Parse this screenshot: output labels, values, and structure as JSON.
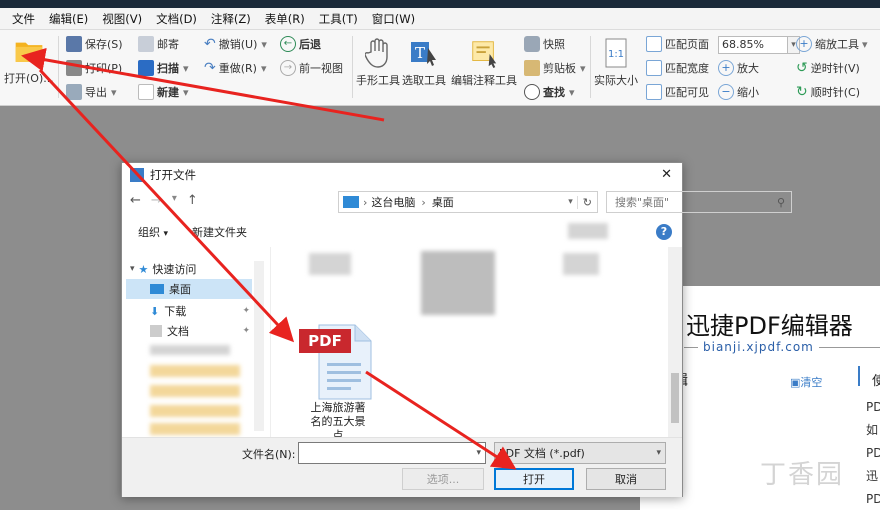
{
  "menu": [
    "文件",
    "编辑(E)",
    "视图(V)",
    "文档(D)",
    "注释(Z)",
    "表单(R)",
    "工具(T)",
    "窗口(W)"
  ],
  "ribbon": {
    "open": "打开(O)...",
    "save": "保存(S)",
    "print": "打印(P)",
    "export": "导出",
    "email": "邮寄",
    "scan": "扫描",
    "new": "新建",
    "undo": "撤销(U)",
    "redo": "重做(R)",
    "back": "后退",
    "forward": "前一视图",
    "hand": "手形工具",
    "select": "选取工具",
    "annotate": "编辑注释工具",
    "snapshot": "快照",
    "clipboard": "剪贴板",
    "find": "查找",
    "actual_size": "实际大小",
    "fit_page": "匹配页面",
    "fit_width": "匹配宽度",
    "fit_visible": "匹配可见",
    "zoom_value": "68.85%",
    "zoom_in": "放大",
    "zoom_out": "缩小",
    "zoom_tool": "缩放工具",
    "rotate_ccw": "逆时针(V)",
    "rotate_cw": "顺时针(C)"
  },
  "dialog": {
    "title": "打开文件",
    "path": [
      "这台电脑",
      "桌面"
    ],
    "search_placeholder": "搜索\"桌面\"",
    "organize": "组织",
    "new_folder": "新建文件夹",
    "nav": [
      "快速访问",
      "桌面",
      "下载",
      "文档"
    ],
    "file_badge": "PDF",
    "file_name": "上海旅游著名的五大景点",
    "filename_label": "文件名(N):",
    "filename_value": "",
    "filetype": "PDF 文档 (*.pdf)",
    "options": "选项...",
    "open": "打开",
    "cancel": "取消"
  },
  "doc": {
    "title": "迅捷PDF编辑器",
    "url": "bianji.xjpdf.com",
    "side_label": "辑",
    "clear": "清空",
    "lines": [
      "PDI",
      "如",
      "PDI",
      "迅",
      "PDI"
    ],
    "bullet": "使"
  },
  "watermark": "丁香园",
  "colors": {
    "arrow": "#e8231f",
    "accent": "#0a5fb4",
    "folder": "#f4b321",
    "pdf_red": "#c9282e"
  }
}
